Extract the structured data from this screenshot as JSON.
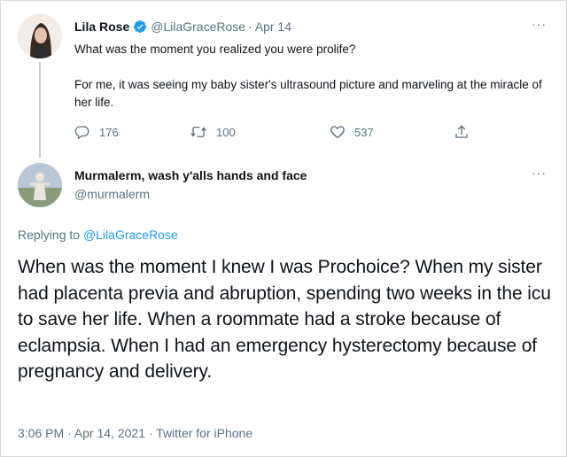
{
  "parent_tweet": {
    "display_name": "Lila Rose",
    "handle": "@LilaGraceRose",
    "separator": "·",
    "date": "Apr 14",
    "more_label": "···",
    "text_line1": "What was the moment you realized you were prolife?",
    "text_line2": "For me, it was seeing my baby sister's ultrasound picture and marveling at the miracle of her life.",
    "replies": "176",
    "retweets": "100",
    "likes": "537"
  },
  "main_tweet": {
    "display_name": "Murmalerm, wash y'alls hands and face",
    "handle": "@murmalerm",
    "more_label": "···",
    "replying_prefix": "Replying to",
    "replying_to": "@LilaGraceRose",
    "text": "When was the moment I knew I was Prochoice? When my sister had placenta previa and abruption, spending two weeks in the icu to save her life. When a roommate had a stroke because of eclampsia. When I had an emergency hysterectomy because of pregnancy and delivery.",
    "timestamp": "3:06 PM · Apr 14, 2021 · Twitter for iPhone"
  },
  "colors": {
    "accent": "#1d9bf0",
    "secondary_text": "#5b7083",
    "primary_text": "#0f1419"
  },
  "icons": [
    "verified-badge-icon",
    "reply-icon",
    "retweet-icon",
    "like-icon",
    "share-icon",
    "more-icon"
  ]
}
